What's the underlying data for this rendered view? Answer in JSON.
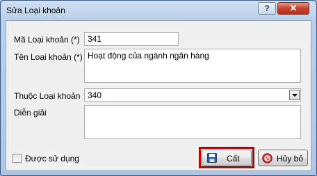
{
  "window": {
    "title": "Sửa Loại khoản",
    "help_label": "?",
    "close_label": "✕"
  },
  "form": {
    "code_label": "Mã Loại khoản (*)",
    "code_value": "341",
    "name_label": "Tên Loại khoản (*)",
    "name_value": "Hoạt động của ngành ngân hàng",
    "parent_label": "Thuộc Loại khoản",
    "parent_value": "340",
    "description_label": "Diễn giải",
    "description_value": "",
    "in_use_label": "Được sử dụng",
    "in_use_checked": false
  },
  "buttons": {
    "save_label": "Cất",
    "cancel_label": "Hủy bỏ"
  },
  "colors": {
    "highlight": "#c00000",
    "cancel_icon": "#d32f2f",
    "save_icon": "#2a5caa"
  }
}
